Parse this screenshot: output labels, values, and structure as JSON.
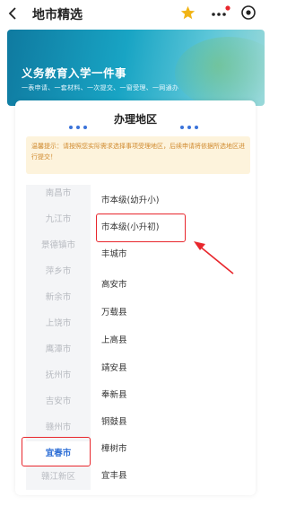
{
  "header": {
    "title": "地市精选",
    "icons": [
      "back-icon",
      "star-icon",
      "more-icon",
      "target-icon"
    ],
    "star_color": "#f1b415",
    "badge_color": "#e8262c"
  },
  "banner": {
    "title": "义务教育入学一件事",
    "subtitle": "一表申请、一套材料、一次提交、一窗受理、一网通办"
  },
  "card": {
    "title": "办理地区",
    "notice": "温馨提示：请按照您实际需求选择事项受理地区，后续申请将依据所选地区进行提交！"
  },
  "cities": [
    {
      "label": "南昌市",
      "active": false
    },
    {
      "label": "九江市",
      "active": false
    },
    {
      "label": "景德镇市",
      "active": false
    },
    {
      "label": "萍乡市",
      "active": false
    },
    {
      "label": "新余市",
      "active": false
    },
    {
      "label": "上饶市",
      "active": false
    },
    {
      "label": "鹰潭市",
      "active": false
    },
    {
      "label": "抚州市",
      "active": false
    },
    {
      "label": "吉安市",
      "active": false
    },
    {
      "label": "赣州市",
      "active": false
    },
    {
      "label": "宜春市",
      "active": true
    },
    {
      "label": "赣江新区",
      "active": false
    }
  ],
  "counties": [
    {
      "label": "市本级(幼升小)"
    },
    {
      "label": "市本级(小升初)",
      "highlighted": true
    },
    {
      "label": "丰城市"
    },
    {
      "label": "高安市"
    },
    {
      "label": "万载县"
    },
    {
      "label": "上高县"
    },
    {
      "label": "靖安县"
    },
    {
      "label": "奉新县"
    },
    {
      "label": "铜鼓县"
    },
    {
      "label": "樟树市"
    },
    {
      "label": "宜丰县"
    }
  ],
  "colors": {
    "accent": "#2f6fd6",
    "highlight": "#e8262c",
    "notice_bg": "#fdf3dc",
    "notice_text": "#d08a2e"
  }
}
